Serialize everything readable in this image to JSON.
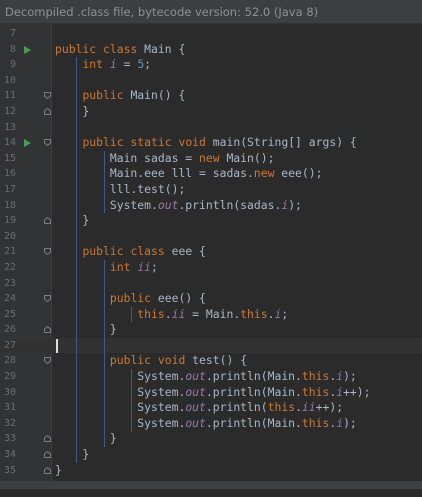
{
  "banner": {
    "text": "Decompiled .class file, bytecode version: 52.0 (Java 8)"
  },
  "editor": {
    "lines": [
      {
        "n": "7"
      },
      {
        "n": "8"
      },
      {
        "n": "9"
      },
      {
        "n": "10"
      },
      {
        "n": "11"
      },
      {
        "n": "12"
      },
      {
        "n": "13"
      },
      {
        "n": "14"
      },
      {
        "n": "15"
      },
      {
        "n": "16"
      },
      {
        "n": "17"
      },
      {
        "n": "18"
      },
      {
        "n": "19"
      },
      {
        "n": "20"
      },
      {
        "n": "21"
      },
      {
        "n": "22"
      },
      {
        "n": "23"
      },
      {
        "n": "24"
      },
      {
        "n": "25"
      },
      {
        "n": "26"
      },
      {
        "n": "27"
      },
      {
        "n": "28"
      },
      {
        "n": "29"
      },
      {
        "n": "30"
      },
      {
        "n": "31"
      },
      {
        "n": "32"
      },
      {
        "n": "33"
      },
      {
        "n": "34"
      },
      {
        "n": "35"
      }
    ],
    "tokens": {
      "public": "public",
      "class": "class",
      "static": "static",
      "void": "void",
      "int": "int",
      "new": "new",
      "this": "this",
      "Main": "Main",
      "eee": "eee",
      "String": "String",
      "args": "args",
      "i": "i",
      "ii": "ii",
      "five": "5",
      "sadas": "sadas",
      "lll": "lll",
      "out": "out",
      "System": "System",
      "println": "println",
      "test": "test",
      "main": "main"
    },
    "current_line": "27"
  },
  "colors": {
    "background": "#2b2b2b",
    "keyword": "#cc7832",
    "field": "#9876aa",
    "number": "#6897bb",
    "text": "#a9b7c6",
    "run_icon": "#499c54"
  }
}
